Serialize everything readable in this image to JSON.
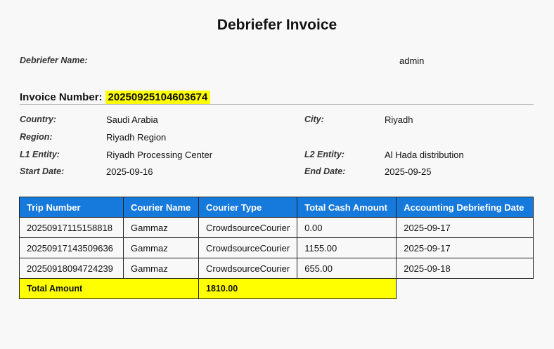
{
  "title": "Debriefer Invoice",
  "debriefer": {
    "label": "Debriefer Name:",
    "value": "admin"
  },
  "invoice": {
    "label": "Invoice Number:",
    "number": "20250925104603674"
  },
  "details": {
    "country": {
      "label": "Country:",
      "value": "Saudi Arabia"
    },
    "city": {
      "label": "City:",
      "value": "Riyadh"
    },
    "region": {
      "label": "Region:",
      "value": "Riyadh Region"
    },
    "l1": {
      "label": "L1 Entity:",
      "value": "Riyadh Processing Center"
    },
    "l2": {
      "label": "L2 Entity:",
      "value": "Al Hada distribution"
    },
    "start": {
      "label": "Start Date:",
      "value": "2025-09-16"
    },
    "end": {
      "label": "End Date:",
      "value": "2025-09-25"
    }
  },
  "table": {
    "headers": [
      "Trip Number",
      "Courier Name",
      "Courier Type",
      "Total Cash Amount",
      "Accounting Debriefing Date"
    ],
    "rows": [
      [
        "20250917115158818",
        "Gammaz",
        "CrowdsourceCourier",
        "0.00",
        "2025-09-17"
      ],
      [
        "20250917143509636",
        "Gammaz",
        "CrowdsourceCourier",
        "1155.00",
        "2025-09-17"
      ],
      [
        "20250918094724239",
        "Gammaz",
        "CrowdsourceCourier",
        "655.00",
        "2025-09-18"
      ]
    ],
    "total_label": "Total Amount",
    "total_value": "1810.00"
  }
}
